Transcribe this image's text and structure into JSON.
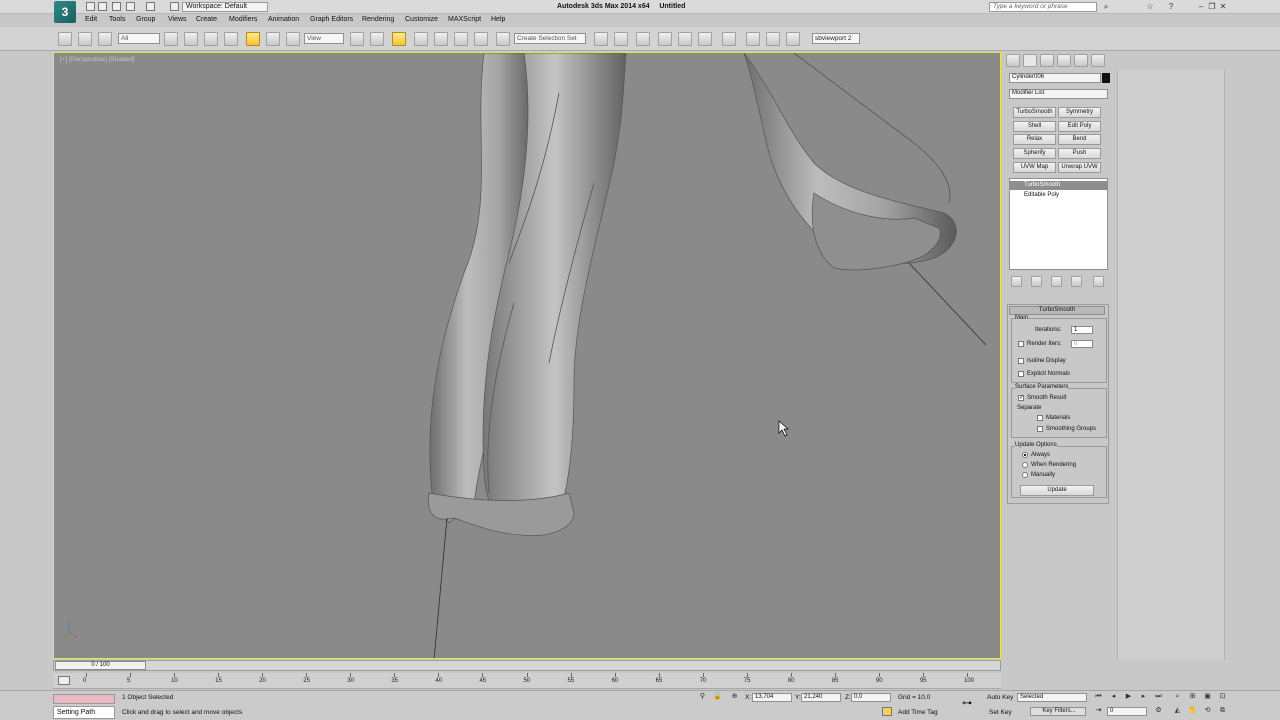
{
  "window": {
    "title": "Autodesk 3ds Max 2014 x64",
    "document": "Untitled",
    "workspace": "Workspace: Default",
    "help_search_placeholder": "Type a keyword or phrase"
  },
  "menu": [
    "Edit",
    "Tools",
    "Group",
    "Views",
    "Create",
    "Modifiers",
    "Animation",
    "Graph Editors",
    "Rendering",
    "Customize",
    "MAXScript",
    "Help"
  ],
  "toolbar": {
    "selection_filter": "All",
    "reference_coord": "View",
    "named_selection_placeholder": "Create Selection Set",
    "viewport_label": "sbviewport 2"
  },
  "viewport": {
    "label": "[+] [Perspective] [Shaded]"
  },
  "command_panel": {
    "object_name": "Cylinder006",
    "modifier_list": "Modifier List",
    "modifier_buttons": [
      "TurboSmooth",
      "Symmetry",
      "Shell",
      "Edit Poly",
      "Relax",
      "Bend",
      "Spherify",
      "Push",
      "UVW Map",
      "Unwrap UVW"
    ],
    "stack": [
      "TurboSmooth",
      "Editable Poly"
    ],
    "rollout": {
      "title": "TurboSmooth",
      "main_label": "Main",
      "iterations_label": "Iterations:",
      "iterations_value": "1",
      "render_iters_label": "Render Iters:",
      "render_iters_value": "0",
      "isoline_label": "Isoline Display",
      "explicit_normals_label": "Explicit Normals",
      "surface_params_label": "Surface Parameters",
      "smooth_result_label": "Smooth Result",
      "separate_label": "Separate",
      "materials_label": "Materials",
      "smoothing_groups_label": "Smoothing Groups",
      "update_options_label": "Update Options",
      "always_label": "Always",
      "when_rendering_label": "When Rendering",
      "manually_label": "Manually",
      "update_button": "Update"
    }
  },
  "timeline": {
    "frame_display": "0 / 100",
    "ticks": [
      "0",
      "5",
      "10",
      "15",
      "20",
      "25",
      "30",
      "35",
      "40",
      "45",
      "50",
      "55",
      "60",
      "65",
      "70",
      "75",
      "80",
      "85",
      "90",
      "95",
      "100"
    ]
  },
  "status": {
    "selection_info": "1 Object Selected",
    "prompt": "Click and drag to select and move objects",
    "listener": "Setting Path",
    "x_value": "13,704",
    "y_value": "21,240",
    "z_value": "0,0",
    "grid": "Grid = 10,0",
    "add_time_tag": "Add Time Tag",
    "auto_key": "Auto Key",
    "set_key": "Set Key",
    "key_mode": "Selected",
    "key_filters": "Key Filters...",
    "current_frame": "0"
  }
}
